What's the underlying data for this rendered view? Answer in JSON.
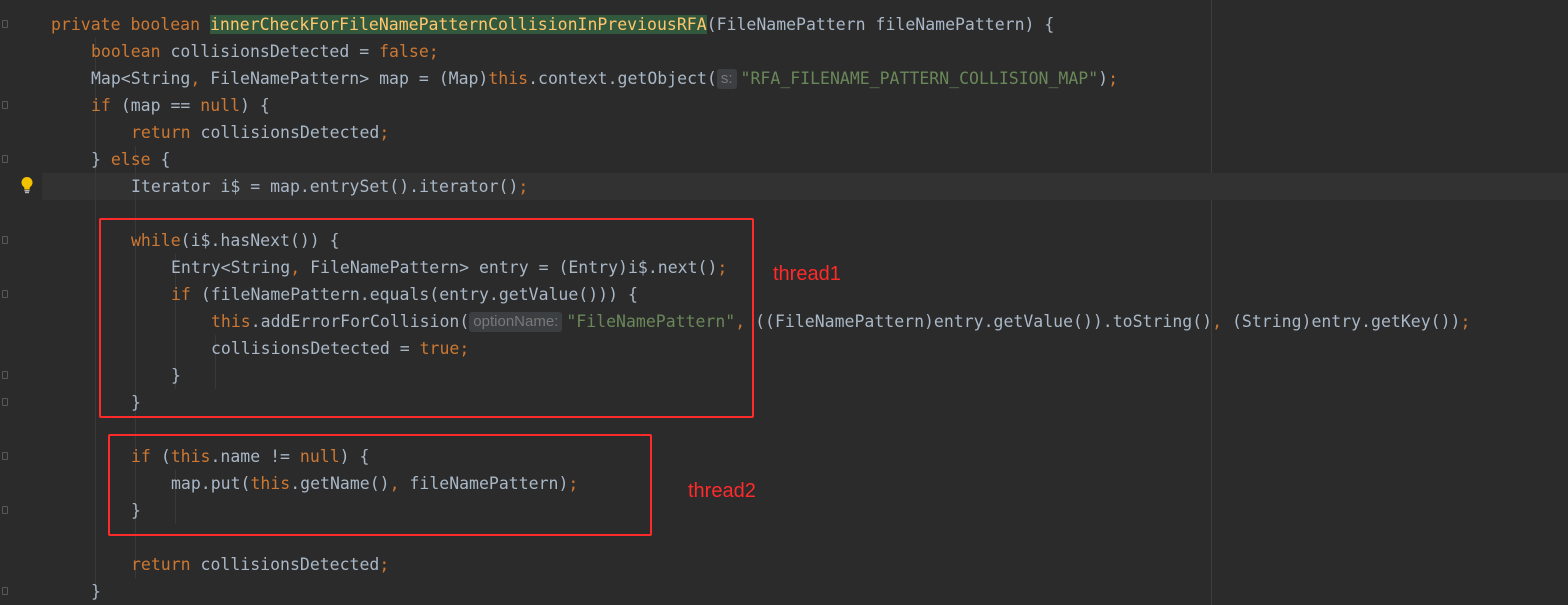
{
  "code": {
    "lines": [
      {
        "tokens": [
          {
            "t": "private boolean ",
            "c": "kw"
          },
          {
            "t": "innerCheckForFileNamePatternCollisionInPreviousRFA",
            "c": "method-hl"
          },
          {
            "t": "(FileNamePattern fileNamePattern) {",
            "c": "plain"
          }
        ]
      },
      {
        "tokens": [
          {
            "t": "boolean ",
            "c": "kw"
          },
          {
            "t": "collisionsDetected = ",
            "c": "plain"
          },
          {
            "t": "false",
            "c": "kw"
          },
          {
            "t": ";",
            "c": "kw"
          }
        ]
      },
      {
        "tokens": [
          {
            "t": "Map<String",
            "c": "plain"
          },
          {
            "t": ", ",
            "c": "kw"
          },
          {
            "t": "FileNamePattern> map = (Map)",
            "c": "plain"
          },
          {
            "t": "this",
            "c": "kw"
          },
          {
            "t": ".context.getObject(",
            "c": "plain"
          },
          {
            "t": "s:",
            "c": "hint"
          },
          {
            "t": "\"RFA_FILENAME_PATTERN_COLLISION_MAP\"",
            "c": "str"
          },
          {
            "t": ")",
            "c": "plain"
          },
          {
            "t": ";",
            "c": "kw"
          }
        ]
      },
      {
        "tokens": [
          {
            "t": "if ",
            "c": "kw"
          },
          {
            "t": "(map == ",
            "c": "plain"
          },
          {
            "t": "null",
            "c": "kw"
          },
          {
            "t": ") {",
            "c": "plain"
          }
        ]
      },
      {
        "tokens": [
          {
            "t": "return ",
            "c": "kw"
          },
          {
            "t": "collisionsDetected",
            "c": "plain"
          },
          {
            "t": ";",
            "c": "kw"
          }
        ]
      },
      {
        "tokens": [
          {
            "t": "} ",
            "c": "plain"
          },
          {
            "t": "else ",
            "c": "kw"
          },
          {
            "t": "{",
            "c": "plain"
          }
        ]
      },
      {
        "tokens": [
          {
            "t": "Iterator i$ = map.entrySet().iterator()",
            "c": "plain"
          },
          {
            "t": ";",
            "c": "kw"
          }
        ]
      },
      {
        "tokens": [
          {
            "t": "while",
            "c": "kw"
          },
          {
            "t": "(i$.hasNext()) {",
            "c": "plain"
          }
        ]
      },
      {
        "tokens": [
          {
            "t": "Entry<String",
            "c": "plain"
          },
          {
            "t": ", ",
            "c": "kw"
          },
          {
            "t": "FileNamePattern> entry = (Entry)i$.next()",
            "c": "plain"
          },
          {
            "t": ";",
            "c": "kw"
          }
        ]
      },
      {
        "tokens": [
          {
            "t": "if ",
            "c": "kw"
          },
          {
            "t": "(fileNamePattern.equals(entry.getValue())) {",
            "c": "plain"
          }
        ]
      },
      {
        "tokens": [
          {
            "t": "this",
            "c": "kw"
          },
          {
            "t": ".addErrorForCollision(",
            "c": "plain"
          },
          {
            "t": "optionName:",
            "c": "hint"
          },
          {
            "t": "\"FileNamePattern\"",
            "c": "str"
          },
          {
            "t": ", ",
            "c": "kw"
          },
          {
            "t": "((FileNamePattern)entry.getValue()).toString()",
            "c": "plain"
          },
          {
            "t": ", ",
            "c": "kw"
          },
          {
            "t": "(String)entry.getKey())",
            "c": "plain"
          },
          {
            "t": ";",
            "c": "kw"
          }
        ]
      },
      {
        "tokens": [
          {
            "t": "collisionsDetected = ",
            "c": "plain"
          },
          {
            "t": "true",
            "c": "kw"
          },
          {
            "t": ";",
            "c": "kw"
          }
        ]
      },
      {
        "tokens": [
          {
            "t": "}",
            "c": "plain"
          }
        ]
      },
      {
        "tokens": [
          {
            "t": "}",
            "c": "plain"
          }
        ]
      },
      {
        "tokens": [
          {
            "t": "if ",
            "c": "kw"
          },
          {
            "t": "(",
            "c": "plain"
          },
          {
            "t": "this",
            "c": "kw"
          },
          {
            "t": ".name != ",
            "c": "plain"
          },
          {
            "t": "null",
            "c": "kw"
          },
          {
            "t": ") {",
            "c": "plain"
          }
        ]
      },
      {
        "tokens": [
          {
            "t": "map.put(",
            "c": "plain"
          },
          {
            "t": "this",
            "c": "kw"
          },
          {
            "t": ".getName()",
            "c": "plain"
          },
          {
            "t": ", ",
            "c": "kw"
          },
          {
            "t": "fileNamePattern)",
            "c": "plain"
          },
          {
            "t": ";",
            "c": "kw"
          }
        ]
      },
      {
        "tokens": [
          {
            "t": "}",
            "c": "plain"
          }
        ]
      },
      {
        "tokens": [
          {
            "t": "return ",
            "c": "kw"
          },
          {
            "t": "collisionsDetected",
            "c": "plain"
          },
          {
            "t": ";",
            "c": "kw"
          }
        ]
      },
      {
        "tokens": [
          {
            "t": "}",
            "c": "plain"
          }
        ]
      }
    ]
  },
  "annotations": {
    "thread1_label": "thread1",
    "thread2_label": "thread2"
  },
  "colors": {
    "background": "#2b2b2b",
    "keyword": "#cc7832",
    "string": "#6a8759",
    "identifier": "#a9b7c6",
    "method_highlight_text": "#ffc66d",
    "method_highlight_bg": "#32593d",
    "annotation_red": "#ff2a2a"
  },
  "icons": {
    "gutter_intention": "lightbulb-icon"
  }
}
